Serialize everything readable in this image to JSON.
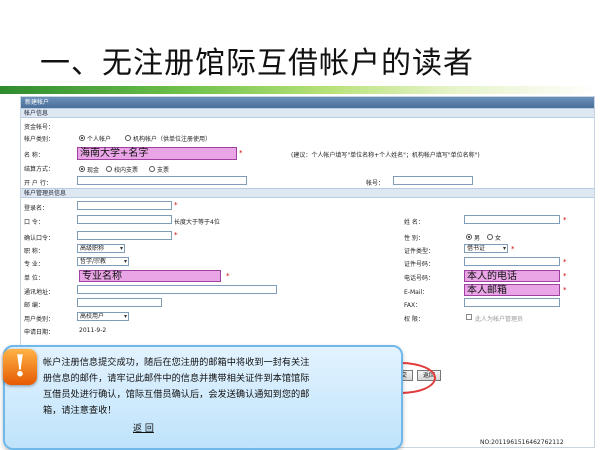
{
  "slide": {
    "title": "一、无注册馆际互借帐户的读者"
  },
  "form": {
    "header": "新建帐户",
    "section_account": "帐户信息",
    "fund_account_label": "资金帐号：",
    "account_type_label": "帐户类别：",
    "account_type_personal": "个人帐户",
    "account_type_institution": "机构帐户（供单位注册使用）",
    "name_label": "名 称：",
    "name_value": "海南大学+名字",
    "name_hint": "(建议：个人帐户填写\"单位名称+个人姓名\"；机构帐户填写\"单位名称\")",
    "settle_label": "结算方式：",
    "settle_cash": "现金",
    "settle_campus": "校内支票",
    "settle_check": "支票",
    "bank_label": "开 户 行：",
    "account_no_label": "帐号：",
    "section_admin": "帐户管理员信息",
    "login_label": "登录名：",
    "password_label": "口 令：",
    "password_hint": "长度大于等于4位",
    "confirm_label": "确认口令：",
    "title_label": "职 称：",
    "title_value": "高级职称",
    "major_label": "专 业：",
    "major_value": "哲学/宗教",
    "unit_label": "单 位：",
    "unit_value": "专业名称",
    "address_label": "通讯地址：",
    "postcode_label": "邮 编：",
    "user_type_label": "用户类别：",
    "user_type_value": "高校用户",
    "date_label": "申请日期：",
    "date_value": "2011-9-2",
    "real_name_label": "姓 名：",
    "gender_label": "性 别：",
    "gender_male": "男",
    "gender_female": "女",
    "id_type_label": "证件类型：",
    "id_type_value": "借书证",
    "id_no_label": "证件号码：",
    "phone_label": "电话号码：",
    "phone_value": "本人的电话",
    "email_label": "E-Mail：",
    "email_value": "本人邮箱",
    "fax_label": "FAX：",
    "privilege_label": "权 限：",
    "privilege_option": "此人为帐户管理员",
    "submit_label": "提交",
    "back_label": "返回"
  },
  "popup": {
    "icon": "exclamation-icon",
    "line1": "帐户注册信息提交成功，随后在您注册的邮箱中将收到一封有关注",
    "line2": "册信息的邮件，请牢记此邮件中的信息并携带相关证件到本馆馆际",
    "line3": "互借员处进行确认，馆际互借员确认后，会发送确认通知到您的邮",
    "line4": "箱，请注意查收！",
    "back": "返 回"
  },
  "footer": {
    "serial": "NO:2011961516462762112"
  },
  "colors": {
    "highlight": "#e9a5e6",
    "ellipse": "#e23b3b",
    "header": "#4a6f9a"
  }
}
